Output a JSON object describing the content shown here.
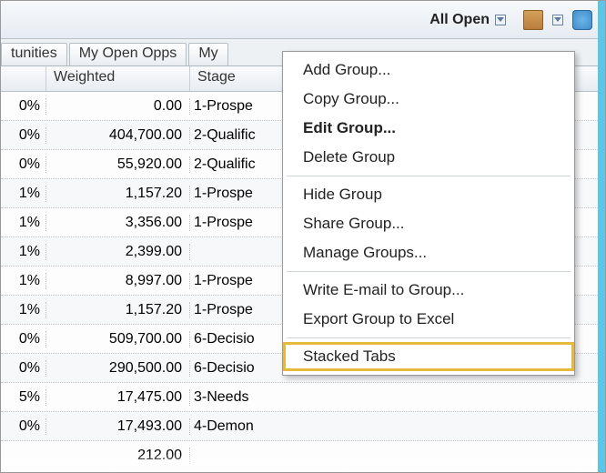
{
  "toolbar": {
    "dropdown_label": "All Open",
    "icons": {
      "people": "group-icon",
      "database": "database-icon"
    }
  },
  "tabs": [
    {
      "label": "tunities"
    },
    {
      "label": "My Open Opps"
    },
    {
      "label": "My"
    }
  ],
  "columns": [
    {
      "label": ""
    },
    {
      "label": "Weighted"
    },
    {
      "label": "Stage"
    }
  ],
  "rows": [
    {
      "pct": "0%",
      "weighted": "0.00",
      "stage": "1-Prospe"
    },
    {
      "pct": "0%",
      "weighted": "404,700.00",
      "stage": "2-Qualific"
    },
    {
      "pct": "0%",
      "weighted": "55,920.00",
      "stage": "2-Qualific"
    },
    {
      "pct": "1%",
      "weighted": "1,157.20",
      "stage": "1-Prospe"
    },
    {
      "pct": "1%",
      "weighted": "3,356.00",
      "stage": "1-Prospe"
    },
    {
      "pct": "1%",
      "weighted": "2,399.00",
      "stage": ""
    },
    {
      "pct": "1%",
      "weighted": "8,997.00",
      "stage": "1-Prospe"
    },
    {
      "pct": "1%",
      "weighted": "1,157.20",
      "stage": "1-Prospe"
    },
    {
      "pct": "0%",
      "weighted": "509,700.00",
      "stage": "6-Decisio"
    },
    {
      "pct": "0%",
      "weighted": "290,500.00",
      "stage": "6-Decisio"
    },
    {
      "pct": "5%",
      "weighted": "17,475.00",
      "stage": "3-Needs"
    },
    {
      "pct": "0%",
      "weighted": "17,493.00",
      "stage": "4-Demon"
    },
    {
      "pct": "",
      "weighted": "212.00",
      "stage": ""
    }
  ],
  "context_menu": {
    "sections": [
      [
        {
          "label": "Add Group..."
        },
        {
          "label": "Copy Group..."
        },
        {
          "label": "Edit Group...",
          "bold": true
        },
        {
          "label": "Delete Group"
        }
      ],
      [
        {
          "label": "Hide Group"
        },
        {
          "label": "Share Group..."
        },
        {
          "label": "Manage Groups..."
        }
      ],
      [
        {
          "label": "Write E-mail to Group..."
        },
        {
          "label": "Export Group to Excel"
        }
      ],
      [
        {
          "label": "Stacked Tabs",
          "highlight": true
        }
      ]
    ]
  }
}
